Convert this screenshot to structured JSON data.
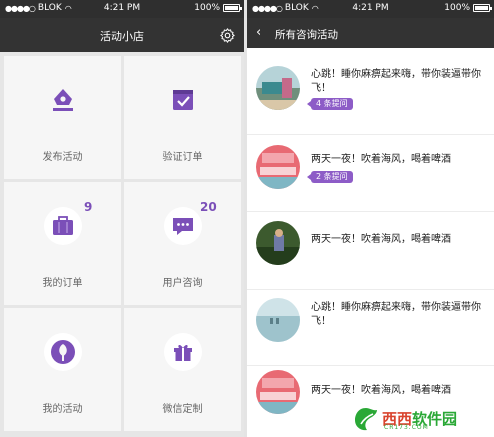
{
  "colors": {
    "accent": "#8d5cc7",
    "icon": "#7b4fb8",
    "navbar": "#333333",
    "statusbar": "#2f2f2f",
    "tile_bg": "#f6f6f6"
  },
  "left": {
    "status": {
      "carrier": "BLOK",
      "time": "4:21 PM",
      "battery": "100%"
    },
    "title": "活动小店",
    "tiles": [
      {
        "label": "发布活动",
        "icon": "publish-icon"
      },
      {
        "label": "验证订单",
        "icon": "verify-order-icon"
      },
      {
        "label": "我的订单",
        "icon": "briefcase-icon",
        "count": "9"
      },
      {
        "label": "用户咨询",
        "icon": "chat-icon",
        "count": "20"
      },
      {
        "label": "我的活动",
        "icon": "tree-icon"
      },
      {
        "label": "微信定制",
        "icon": "gift-icon"
      }
    ]
  },
  "right": {
    "status": {
      "carrier": "BLOK",
      "time": "4:21 PM",
      "battery": "100%"
    },
    "title": "所有咨询活动",
    "items": [
      {
        "text": "心跳！睡你麻痹起来嗨，带你装逼带你飞！",
        "badge": "4 条提问"
      },
      {
        "text": "两天一夜！吹着海风，喝着啤酒",
        "badge": "2 条提问"
      },
      {
        "text": "两天一夜！吹着海风，喝着啤酒",
        "badge": ""
      },
      {
        "text": "心跳！睡你麻痹起来嗨，带你装逼带你飞！",
        "badge": ""
      },
      {
        "text": "两天一夜！吹着海风，喝着啤酒",
        "badge": ""
      }
    ]
  },
  "watermark": {
    "text_a": "西西",
    "text_b": "软件园",
    "sub": "CR173.COM"
  }
}
